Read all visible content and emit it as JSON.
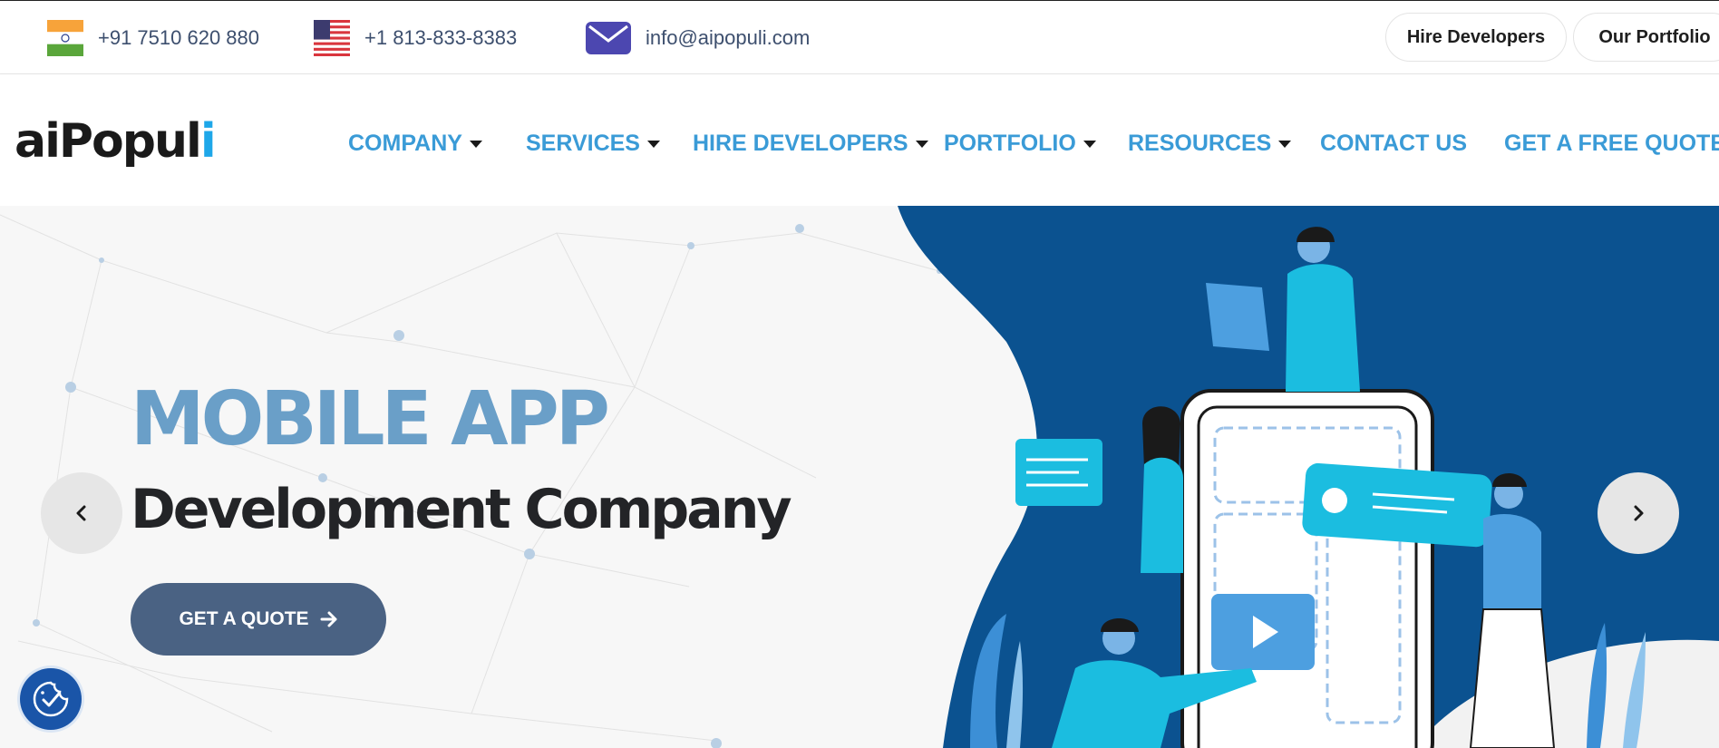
{
  "topbar": {
    "phone_india": "+91 7510 620 880",
    "phone_us": "+1 813-833-8383",
    "email": "info@aipopuli.com",
    "hire_button": "Hire Developers",
    "portfolio_button": "Our Portfolio"
  },
  "logo": {
    "part1": "ai",
    "part2": "Popul",
    "part3": "i"
  },
  "nav": {
    "company": "COMPANY",
    "services": "SERVICES",
    "hire": "HIRE DEVELOPERS",
    "portfolio": "PORTFOLIO",
    "resources": "RESOURCES",
    "contact": "CONTACT US",
    "quote": "GET A FREE QUOTE"
  },
  "hero": {
    "title_line1": "MOBILE APP",
    "title_line2": "Development Company",
    "cta": "GET A QUOTE"
  },
  "icons": {
    "india_flag": "india-flag-icon",
    "us_flag": "us-flag-icon",
    "mail": "mail-icon",
    "prev": "chevron-left-icon",
    "next": "chevron-right-icon",
    "cookie": "cookie-consent-icon"
  },
  "colors": {
    "nav_link": "#3a9bd7",
    "hero_blue": "#0b5290",
    "title_blue": "#6a9fc8",
    "cta_bg": "#4a6283",
    "mail_purple": "#4c47b0"
  }
}
